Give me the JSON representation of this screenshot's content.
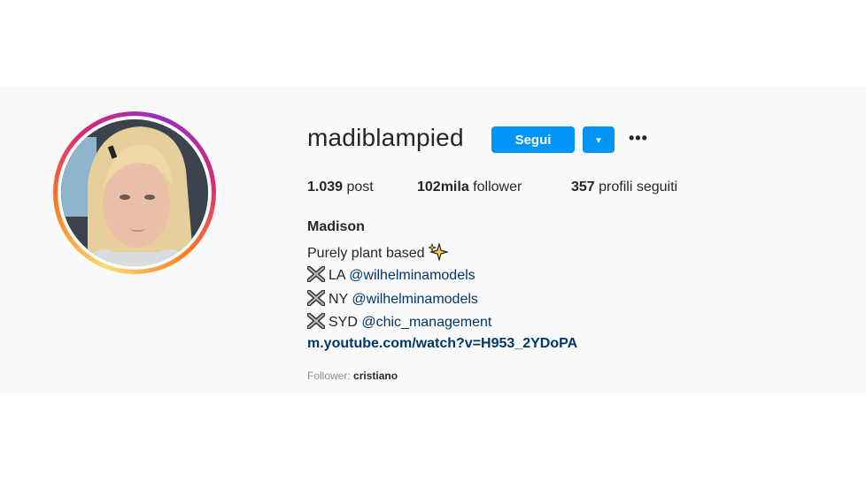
{
  "profile": {
    "username": "madiblampied",
    "follow_label": "Segui",
    "dropdown_label": "▾",
    "more_label": "•••"
  },
  "stats": {
    "posts_count": "1.039",
    "posts_label": "post",
    "followers_count": "102mila",
    "followers_label": "follower",
    "following_count": "357",
    "following_label": "profili seguiti"
  },
  "bio": {
    "name": "Madison",
    "tagline": "Purely plant based",
    "lines": [
      {
        "prefix": "LA",
        "handle": "@wilhelminamodels"
      },
      {
        "prefix": "NY",
        "handle": "@wilhelminamodels"
      },
      {
        "prefix": "SYD",
        "handle": "@chic_management"
      }
    ],
    "url": "m.youtube.com/watch?v=H953_2YDoPA"
  },
  "followed_by": {
    "label": "Follower:",
    "name": "cristiano"
  },
  "colors": {
    "accent": "#0095f6",
    "link": "#00376b",
    "background": "#fafafa"
  },
  "icons": [
    "sparkles-icon",
    "cross-mark-icon",
    "more-icon",
    "chevron-down-icon"
  ]
}
